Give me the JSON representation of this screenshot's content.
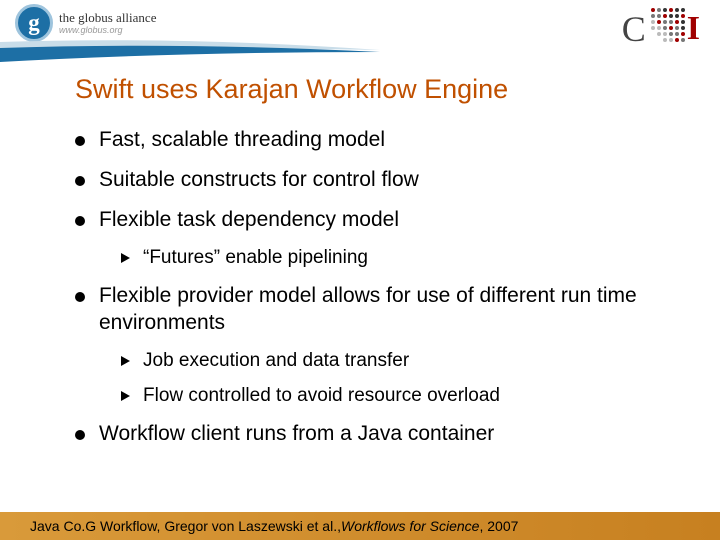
{
  "header": {
    "globus": {
      "g": "g",
      "title": "the globus alliance",
      "url": "www.globus.org"
    },
    "ci": {
      "c": "C",
      "i": "I"
    }
  },
  "title": "Swift uses Karajan Workflow Engine",
  "bullets": [
    {
      "text": "Fast, scalable threading model",
      "sub": []
    },
    {
      "text": "Suitable constructs for control flow",
      "sub": []
    },
    {
      "text": "Flexible task dependency model",
      "sub": [
        {
          "text": "“Futures” enable pipelining"
        }
      ]
    },
    {
      "text": "Flexible provider model allows for use of different run time environments",
      "sub": [
        {
          "text": "Job execution and data transfer"
        },
        {
          "text": "Flow controlled to avoid resource overload"
        }
      ]
    },
    {
      "text": "Workflow client runs from a Java container",
      "sub": []
    }
  ],
  "footer": {
    "prefix": "Java Co.G Workflow, Gregor von Laszewski et al., ",
    "italic": "Workflows for Science",
    "suffix": ", 2007"
  }
}
